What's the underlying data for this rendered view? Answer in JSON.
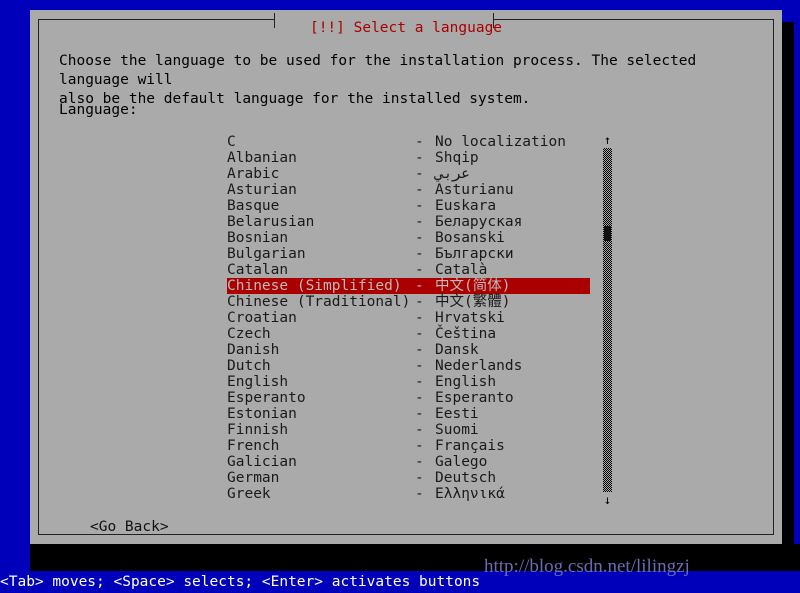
{
  "window": {
    "title": "[!!] Select a language",
    "title_color": "#aa0000",
    "panel_color": "#aaaaaa",
    "desktop_color": "#0000bb"
  },
  "intro": {
    "text": "Choose the language to be used for the installation process. The selected language will\nalso be the default language for the installed system."
  },
  "form": {
    "language_label": "Language:"
  },
  "list": {
    "separator": "-",
    "selected_index": 9,
    "items": [
      {
        "name": "C",
        "native": "No localization"
      },
      {
        "name": "Albanian",
        "native": "Shqip"
      },
      {
        "name": "Arabic",
        "native": "عربي"
      },
      {
        "name": "Asturian",
        "native": "Asturianu"
      },
      {
        "name": "Basque",
        "native": "Euskara"
      },
      {
        "name": "Belarusian",
        "native": "Беларуская"
      },
      {
        "name": "Bosnian",
        "native": "Bosanski"
      },
      {
        "name": "Bulgarian",
        "native": "Български"
      },
      {
        "name": "Catalan",
        "native": "Català"
      },
      {
        "name": "Chinese (Simplified)",
        "native": "中文(简体)"
      },
      {
        "name": "Chinese (Traditional)",
        "native": "中文(繁體)"
      },
      {
        "name": "Croatian",
        "native": "Hrvatski"
      },
      {
        "name": "Czech",
        "native": "Čeština"
      },
      {
        "name": "Danish",
        "native": "Dansk"
      },
      {
        "name": "Dutch",
        "native": "Nederlands"
      },
      {
        "name": "English",
        "native": "English"
      },
      {
        "name": "Esperanto",
        "native": "Esperanto"
      },
      {
        "name": "Estonian",
        "native": "Eesti"
      },
      {
        "name": "Finnish",
        "native": "Suomi"
      },
      {
        "name": "French",
        "native": "Français"
      },
      {
        "name": "Galician",
        "native": "Galego"
      },
      {
        "name": "German",
        "native": "Deutsch"
      },
      {
        "name": "Greek",
        "native": "Ελληνικά"
      }
    ]
  },
  "scrollbar": {
    "up_arrow": "↑",
    "down_arrow": "↓"
  },
  "buttons": {
    "go_back": "<Go Back>"
  },
  "statusbar": {
    "text": "<Tab> moves; <Space> selects; <Enter> activates buttons",
    "background": "#0000bb",
    "foreground": "#ffffff"
  },
  "watermark": {
    "text": "http://blog.csdn.net/lilingzj"
  }
}
